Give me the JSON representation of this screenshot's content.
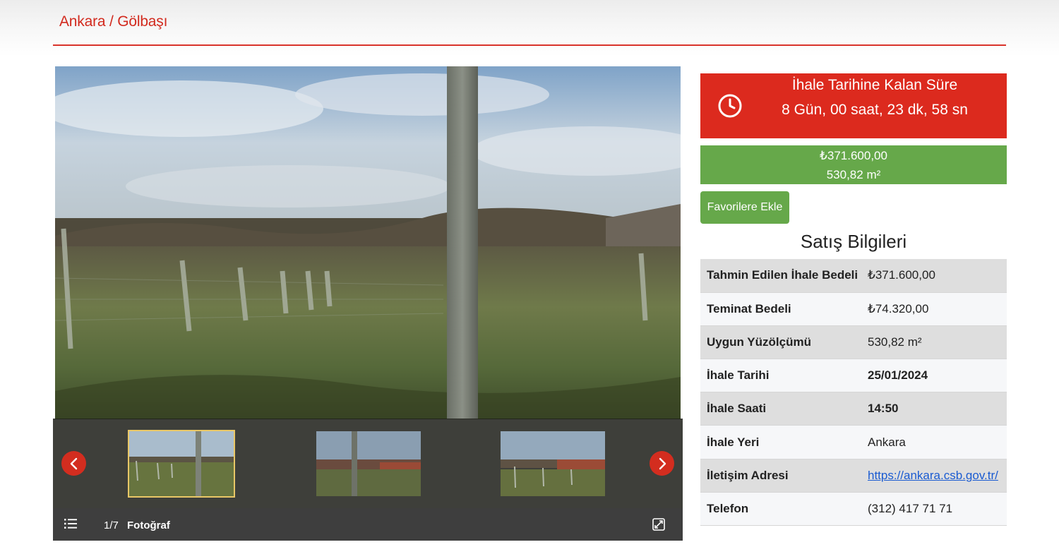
{
  "breadcrumb": "Ankara / Gölbaşı",
  "gallery": {
    "counter": "1/7",
    "label": "Fotoğraf",
    "total_photos": 7,
    "current_photo": 1
  },
  "countdown": {
    "title": "İhale Tarihine Kalan Süre",
    "remaining": "8 Gün, 00 saat, 23 dk, 58 sn"
  },
  "summary": {
    "price": "₺371.600,00",
    "area": "530,82 m²"
  },
  "favorite_button": "Favorilere Ekle",
  "section_title": "Satış Bilgileri",
  "info_rows": [
    {
      "key": "Tahmin Edilen İhale Bedeli",
      "value": "₺371.600,00"
    },
    {
      "key": "Teminat Bedeli",
      "value": "₺74.320,00"
    },
    {
      "key": "Uygun Yüzölçümü",
      "value": "530,82 m²"
    },
    {
      "key": "İhale Tarihi",
      "value": "25/01/2024"
    },
    {
      "key": "İhale Saati",
      "value": "14:50"
    },
    {
      "key": "İhale Yeri",
      "value": "Ankara"
    },
    {
      "key": "İletişim Adresi",
      "value": "https://ankara.csb.gov.tr/"
    },
    {
      "key": "Telefon",
      "value": "(312) 417 71 71"
    }
  ],
  "colors": {
    "brand_red": "#dc2a1e",
    "success_green": "#66a84a",
    "link_blue": "#1a5bd1"
  },
  "icons": [
    "clock-icon",
    "chevron-left-icon",
    "chevron-right-icon",
    "list-icon",
    "expand-icon"
  ]
}
